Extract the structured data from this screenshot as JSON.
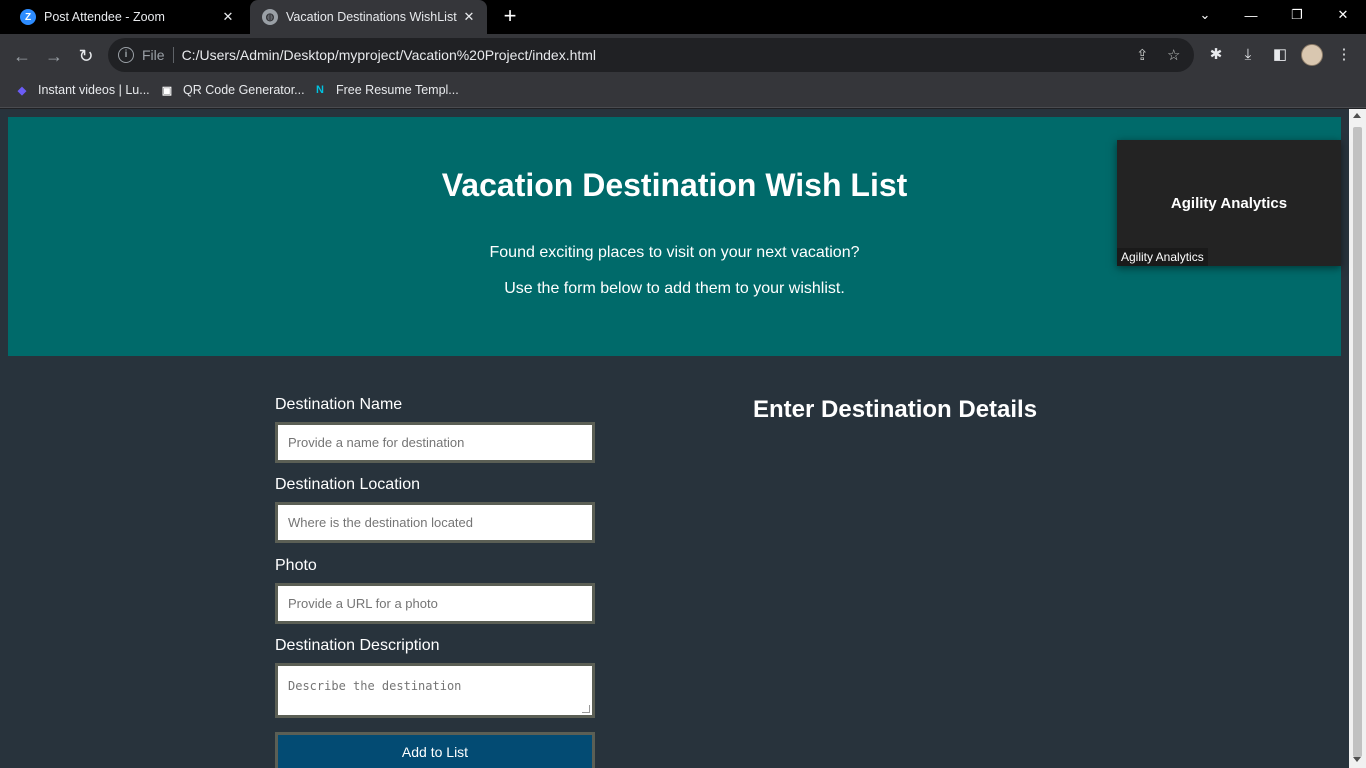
{
  "browser": {
    "tabs": [
      {
        "title": "Post Attendee - Zoom",
        "favicon": "Z",
        "close": "✕"
      },
      {
        "title": "Vacation Destinations WishList",
        "favicon": "◍",
        "close": "✕"
      }
    ],
    "new_tab": "+",
    "window_controls": {
      "tab_search": "⌄",
      "minimize": "—",
      "restore": "❐",
      "close": "✕"
    },
    "nav": {
      "back": "←",
      "forward": "→",
      "reload": "↻"
    },
    "address": {
      "info": "i",
      "scheme": "File",
      "url": "C:/Users/Admin/Desktop/myproject/Vacation%20Project/index.html"
    },
    "address_icons": {
      "share": "⇪",
      "star": "☆"
    },
    "toolbar_icons": {
      "extensions": "✱",
      "downloads": "⤓",
      "side_panel": "◧",
      "menu": "⋮"
    },
    "bookmarks": [
      {
        "label": "Instant videos | Lu...",
        "icon": "◆",
        "icon_color": "#6b5cf6"
      },
      {
        "label": "QR Code Generator...",
        "icon": "▣",
        "icon_color": "#ffffff"
      },
      {
        "label": "Free Resume Templ...",
        "icon": "N",
        "icon_color": "#00c2e0"
      }
    ]
  },
  "page": {
    "banner": {
      "title": "Vacation Destination Wish List",
      "line1": "Found exciting places to visit on your next vacation?",
      "line2": "Use the form below to add them to your wishlist."
    },
    "form": {
      "name_label": "Destination Name",
      "name_placeholder": "Provide a name for destination",
      "location_label": "Destination Location",
      "location_placeholder": "Where is the destination located",
      "photo_label": "Photo",
      "photo_placeholder": "Provide a URL for a photo",
      "description_label": "Destination Description",
      "description_placeholder": "Describe the destination",
      "submit_label": "Add to List"
    },
    "details_heading": "Enter Destination Details"
  },
  "zoom_overlay": {
    "participant_name": "Agility Analytics",
    "name_tag": "Agility Analytics"
  },
  "colors": {
    "banner_bg": "#006a6a",
    "page_bg": "#28333c",
    "button_bg": "#034b73"
  }
}
